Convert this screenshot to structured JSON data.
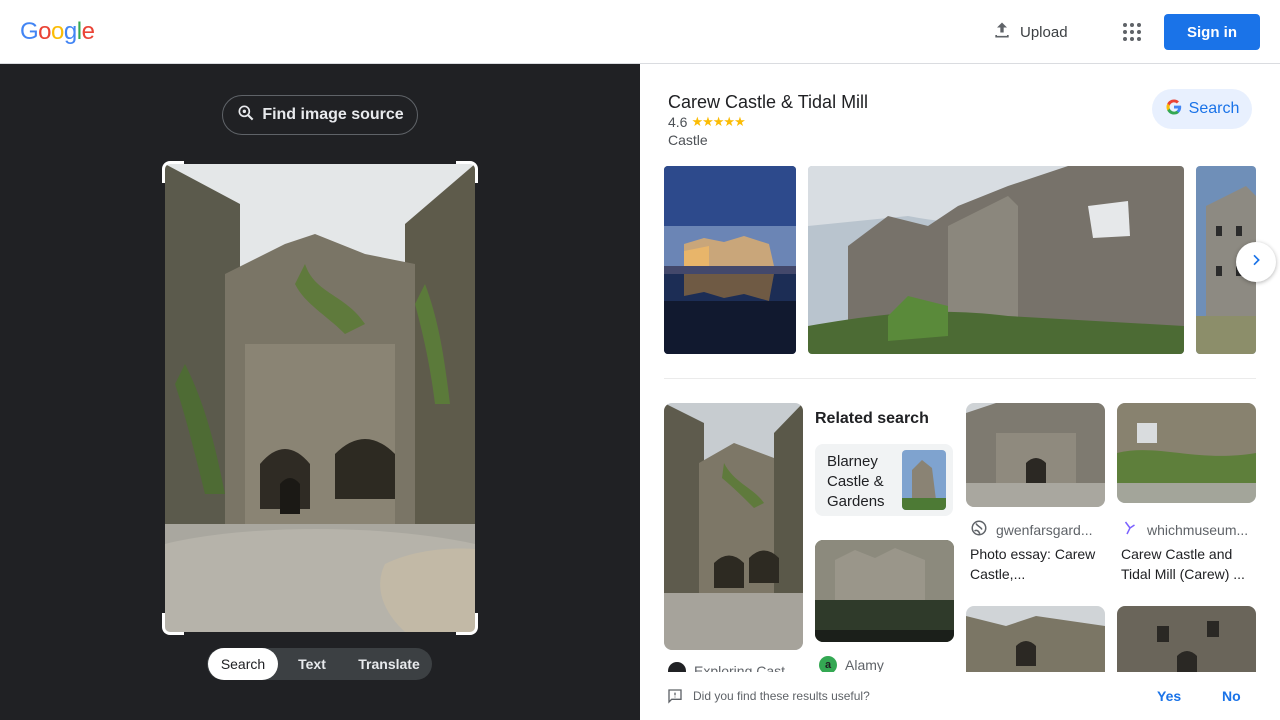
{
  "header": {
    "logo_letters": [
      "G",
      "o",
      "o",
      "g",
      "l",
      "e"
    ],
    "upload_label": "Upload",
    "signin_label": "Sign in",
    "colors": {
      "signin_bg": "#1a73e8"
    }
  },
  "left_pane": {
    "find_source_label": "Find image source",
    "modes": [
      "Search",
      "Text",
      "Translate"
    ],
    "active_mode": "Search"
  },
  "place": {
    "title": "Carew Castle & Tidal Mill",
    "rating": "4.6",
    "stars": "★★★★★",
    "type": "Castle",
    "search_label": "Search"
  },
  "results": {
    "related_title": "Related search",
    "related_item": "Blarney Castle & Gardens",
    "items": [
      {
        "source": "Exploring Cast",
        "caption": ""
      },
      {
        "source": "Alamy",
        "caption": ""
      },
      {
        "source": "gwenfarsgard...",
        "caption": "Photo essay: Carew Castle,..."
      },
      {
        "source": "whichmuseum...",
        "caption": "Carew Castle and Tidal Mill (Carew) ..."
      }
    ]
  },
  "feedback": {
    "question": "Did you find these results useful?",
    "yes": "Yes",
    "no": "No"
  },
  "icons": [
    "upload-icon",
    "apps-grid-icon",
    "lens-search-icon",
    "google-g-icon",
    "chevron-right-icon",
    "globe-icon",
    "feedback-icon"
  ]
}
